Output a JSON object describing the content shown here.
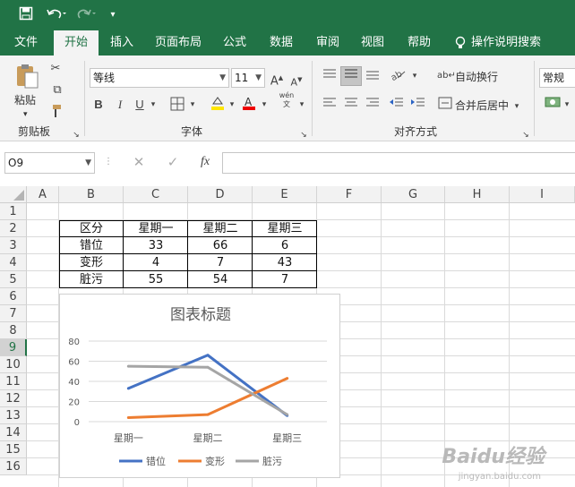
{
  "qat": {
    "save_icon": "save-icon",
    "undo_icon": "undo-icon",
    "redo_icon": "redo-icon",
    "customize_icon": "customize-qat-icon"
  },
  "tabs": [
    {
      "label": "文件"
    },
    {
      "label": "开始"
    },
    {
      "label": "插入"
    },
    {
      "label": "页面布局"
    },
    {
      "label": "公式"
    },
    {
      "label": "数据"
    },
    {
      "label": "审阅"
    },
    {
      "label": "视图"
    },
    {
      "label": "帮助"
    },
    {
      "label": "操作说明搜索"
    }
  ],
  "ribbon": {
    "paste_label": "粘贴",
    "clipboard_label": "剪贴板",
    "font_name": "等线",
    "font_size": "11",
    "font_group_label": "字体",
    "bold": "B",
    "italic": "I",
    "underline": "U",
    "wrap_text": "自动换行",
    "merge_center": "合并后居中",
    "align_group_label": "对齐方式",
    "number_format": "常规",
    "phonetic": "wén"
  },
  "formula_bar": {
    "name_box": "O9",
    "fx": "fx",
    "value": ""
  },
  "columns": [
    "A",
    "B",
    "C",
    "D",
    "E",
    "F",
    "G",
    "H",
    "I"
  ],
  "rows": [
    "1",
    "2",
    "3",
    "4",
    "5",
    "6",
    "7",
    "8",
    "9",
    "10",
    "11",
    "12",
    "13",
    "14",
    "15",
    "16"
  ],
  "table": {
    "header": [
      "区分",
      "星期一",
      "星期二",
      "星期三"
    ],
    "rows": [
      [
        "错位",
        "33",
        "66",
        "6"
      ],
      [
        "变形",
        "4",
        "7",
        "43"
      ],
      [
        "脏污",
        "55",
        "54",
        "7"
      ]
    ]
  },
  "chart_data": {
    "type": "line",
    "title": "图表标题",
    "categories": [
      "星期一",
      "星期二",
      "星期三"
    ],
    "series": [
      {
        "name": "错位",
        "values": [
          33,
          66,
          6
        ],
        "color": "#4472c4"
      },
      {
        "name": "变形",
        "values": [
          4,
          7,
          43
        ],
        "color": "#ed7d31"
      },
      {
        "name": "脏污",
        "values": [
          55,
          54,
          7
        ],
        "color": "#a5a5a5"
      }
    ],
    "ylim": [
      0,
      80
    ],
    "yticks": [
      "0",
      "20",
      "40",
      "60",
      "80"
    ],
    "grid": true,
    "legend": "bottom"
  },
  "watermark": {
    "main": "Baidu经验",
    "sub": "jingyan.baidu.com"
  }
}
